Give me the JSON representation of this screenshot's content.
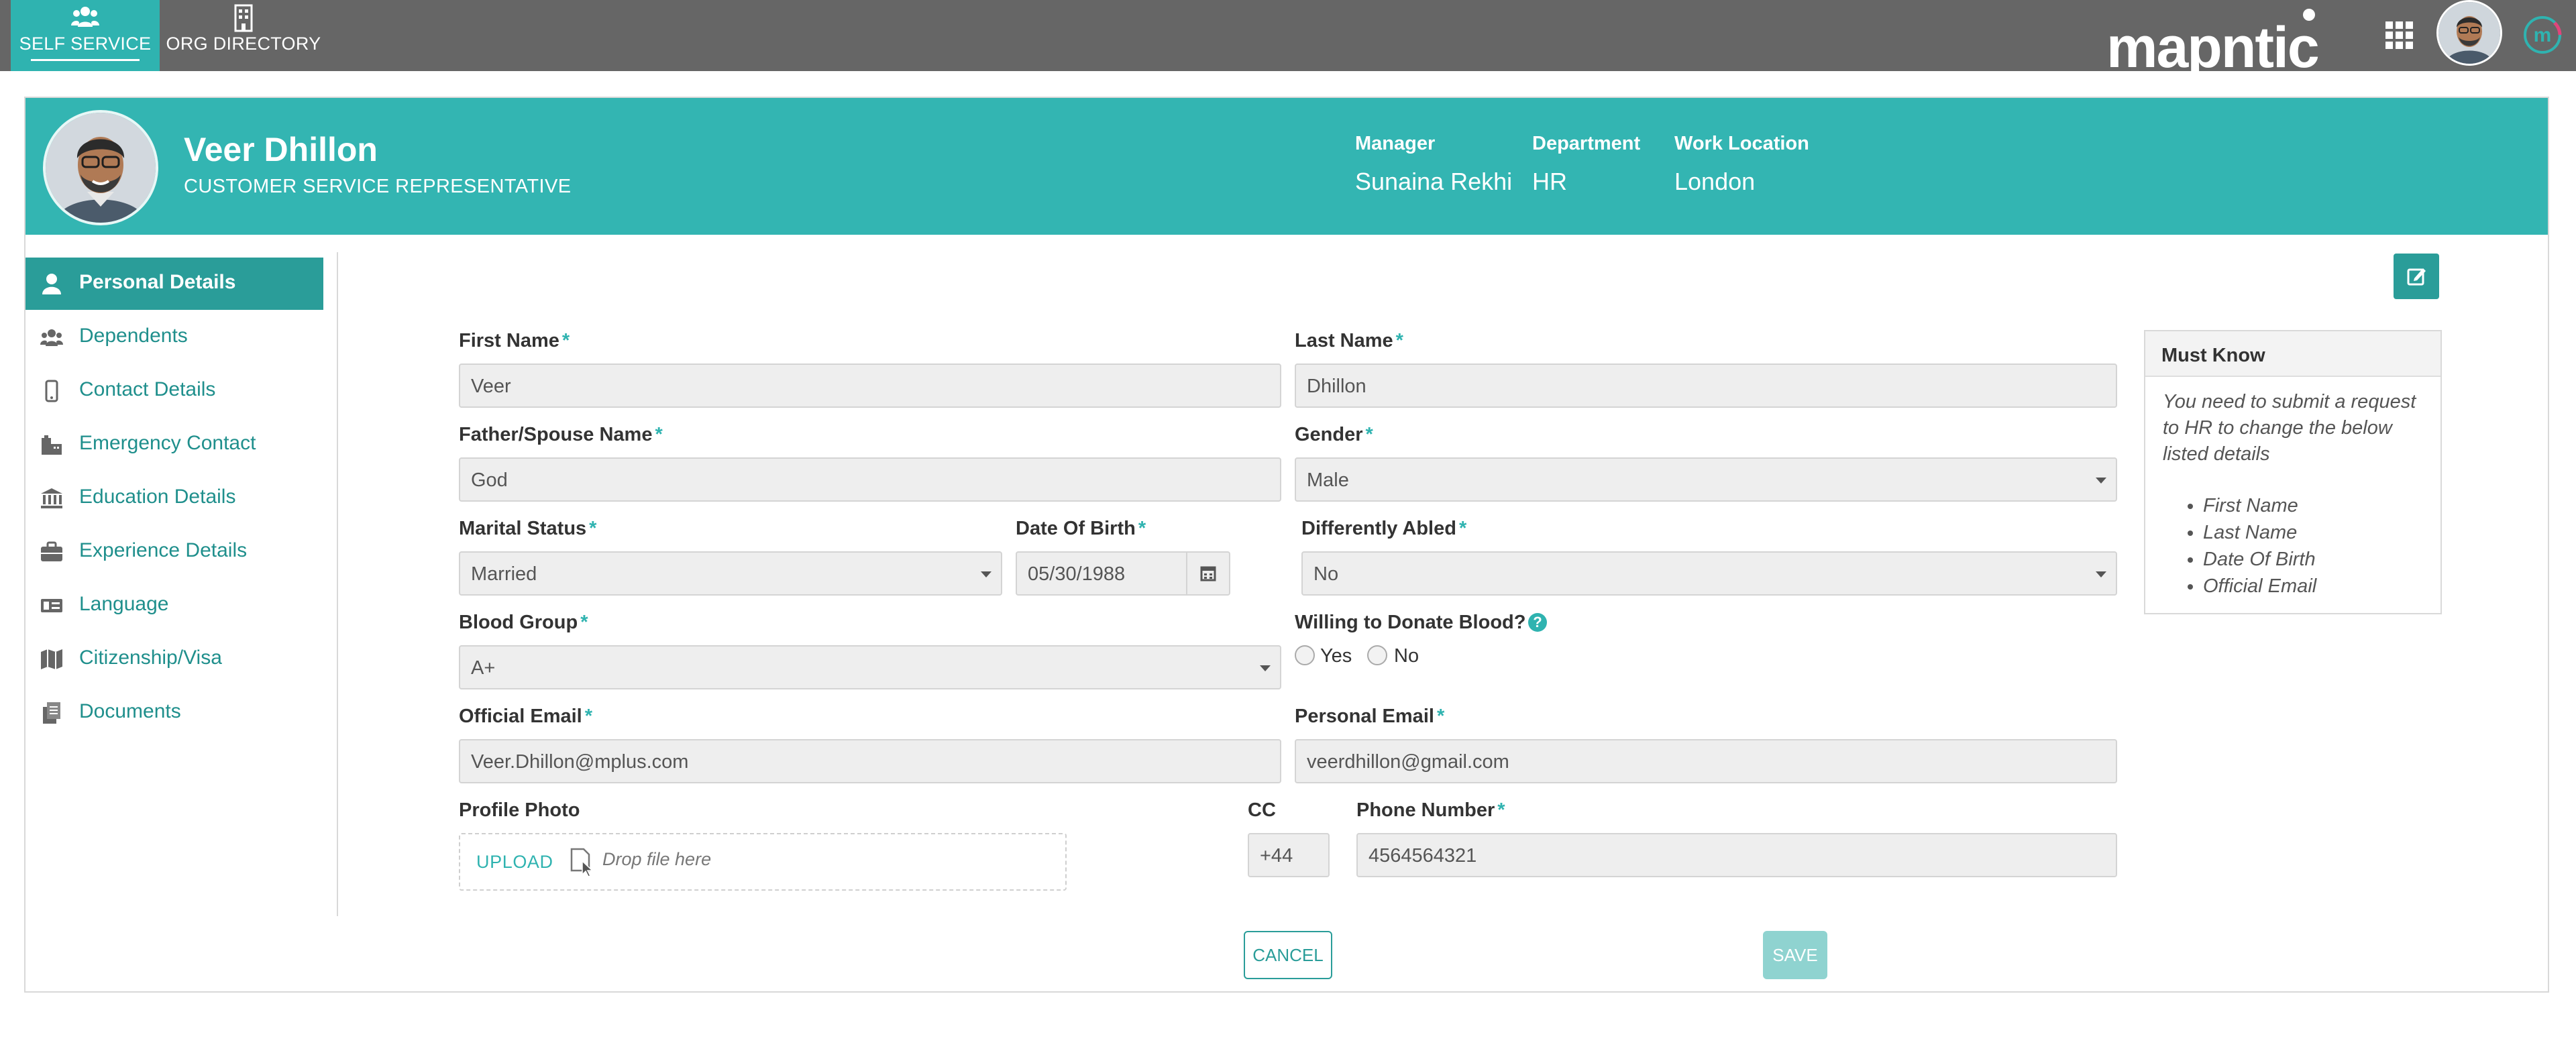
{
  "topbar": {
    "nav": [
      {
        "label": "SELF SERVICE",
        "icon": "users-icon",
        "active": true
      },
      {
        "label": "ORG DIRECTORY",
        "icon": "building-icon",
        "active": false
      }
    ],
    "brand": "mapntic",
    "brand_badge": "m"
  },
  "employee": {
    "name": "Veer Dhillon",
    "title": "CUSTOMER SERVICE REPRESENTATIVE",
    "manager_label": "Manager",
    "manager": "Sunaina Rekhi",
    "department_label": "Department",
    "department": "HR",
    "location_label": "Work Location",
    "location": "London"
  },
  "sidebar": {
    "items": [
      {
        "label": "Personal Details",
        "icon": "user-icon",
        "active": true
      },
      {
        "label": "Dependents",
        "icon": "users-icon"
      },
      {
        "label": "Contact Details",
        "icon": "mobile-icon"
      },
      {
        "label": "Emergency Contact",
        "icon": "emergency-icon"
      },
      {
        "label": "Education Details",
        "icon": "institution-icon"
      },
      {
        "label": "Experience Details",
        "icon": "briefcase-icon"
      },
      {
        "label": "Language",
        "icon": "language-icon"
      },
      {
        "label": "Citizenship/Visa",
        "icon": "map-icon"
      },
      {
        "label": "Documents",
        "icon": "documents-icon"
      }
    ]
  },
  "form": {
    "first_name": {
      "label": "First Name",
      "value": "Veer"
    },
    "last_name": {
      "label": "Last Name",
      "value": "Dhillon"
    },
    "father_spouse": {
      "label": "Father/Spouse Name",
      "value": "God"
    },
    "gender": {
      "label": "Gender",
      "value": "Male"
    },
    "marital_status": {
      "label": "Marital Status",
      "value": "Married"
    },
    "dob": {
      "label": "Date Of Birth",
      "value": "05/30/1988"
    },
    "differently_abled": {
      "label": "Differently Abled",
      "value": "No"
    },
    "blood_group": {
      "label": "Blood Group",
      "value": "A+"
    },
    "donate_blood": {
      "label": "Willing to Donate Blood?",
      "yes": "Yes",
      "no": "No"
    },
    "official_email": {
      "label": "Official Email",
      "value": "Veer.Dhillon@mplus.com"
    },
    "personal_email": {
      "label": "Personal Email",
      "value": "veerdhillon@gmail.com"
    },
    "profile_photo": {
      "label": "Profile Photo",
      "upload": "UPLOAD",
      "drop": "Drop file here"
    },
    "cc": {
      "label": "CC",
      "value": "+44"
    },
    "phone": {
      "label": "Phone Number",
      "value": "4564564321"
    },
    "required_mark": "*"
  },
  "must_know": {
    "title": "Must Know",
    "text": "You need to submit a request to HR to change the below listed details",
    "items": [
      "First Name",
      "Last Name",
      "Date Of Birth",
      "Official Email"
    ]
  },
  "actions": {
    "cancel": "CANCEL",
    "save": "SAVE"
  },
  "colors": {
    "accent": "#2fb3b0",
    "accent_dark": "#2a9d99",
    "topbar": "#666666"
  }
}
